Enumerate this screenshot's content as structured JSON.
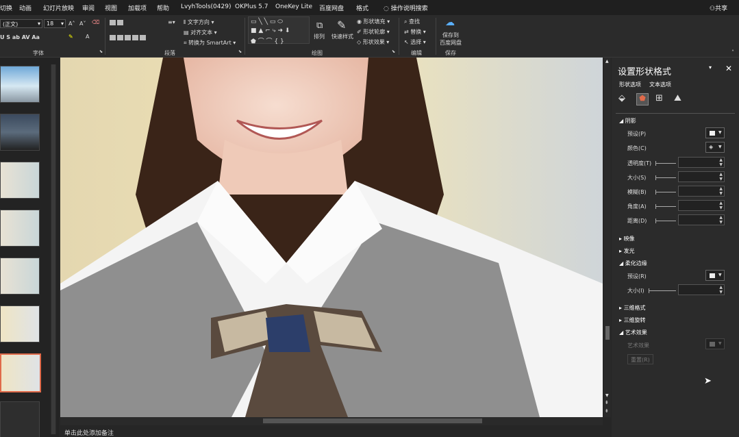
{
  "menubar": {
    "tabs": [
      "切换",
      "动画",
      "幻灯片放映",
      "审阅",
      "视图",
      "加载项",
      "帮助",
      "LvyhTools(0429)",
      "OKPlus 5.7",
      "OneKey Lite",
      "百度网盘",
      "格式"
    ],
    "tell_me": "操作说明搜索",
    "share": "共享"
  },
  "ribbon": {
    "font_name": "(正文)",
    "font_size": "18",
    "font_group": "字体",
    "paragraph_group": "段落",
    "drawing_group": "绘图",
    "editing_group": "编辑",
    "save_group": "保存",
    "text_direction": "文字方向",
    "align_text": "对齐文本",
    "convert_smartart": "转换为 SmartArt",
    "arrange": "排列",
    "quick_styles": "快速样式",
    "shape_fill": "形状填充",
    "shape_outline": "形状轮廓",
    "shape_effects": "形状效果",
    "find": "查找",
    "replace": "替换",
    "select": "选择",
    "save_baidu_line1": "保存到",
    "save_baidu_line2": "百度网盘"
  },
  "notes": {
    "placeholder": "单击此处添加备注"
  },
  "panel": {
    "title": "设置形状格式",
    "tab_shape": "形状选项",
    "tab_text": "文本选项",
    "shadow": {
      "title": "阴影",
      "preset": "预设(P)",
      "color": "颜色(C)",
      "transparency": "透明度(T)",
      "size": "大小(S)",
      "blur": "模糊(B)",
      "angle": "角度(A)",
      "distance": "距离(D)"
    },
    "reflection": "映像",
    "glow": "发光",
    "soft_edges": {
      "title": "柔化边缘",
      "preset": "预设(R)",
      "size": "大小(I)"
    },
    "format_3d": "三维格式",
    "rotation_3d": "三维旋转",
    "artistic": {
      "title": "艺术效果",
      "effect": "艺术效果",
      "reset": "重置(R)"
    }
  },
  "colors": {
    "accent": "#e06a4a",
    "background": "#262626"
  }
}
